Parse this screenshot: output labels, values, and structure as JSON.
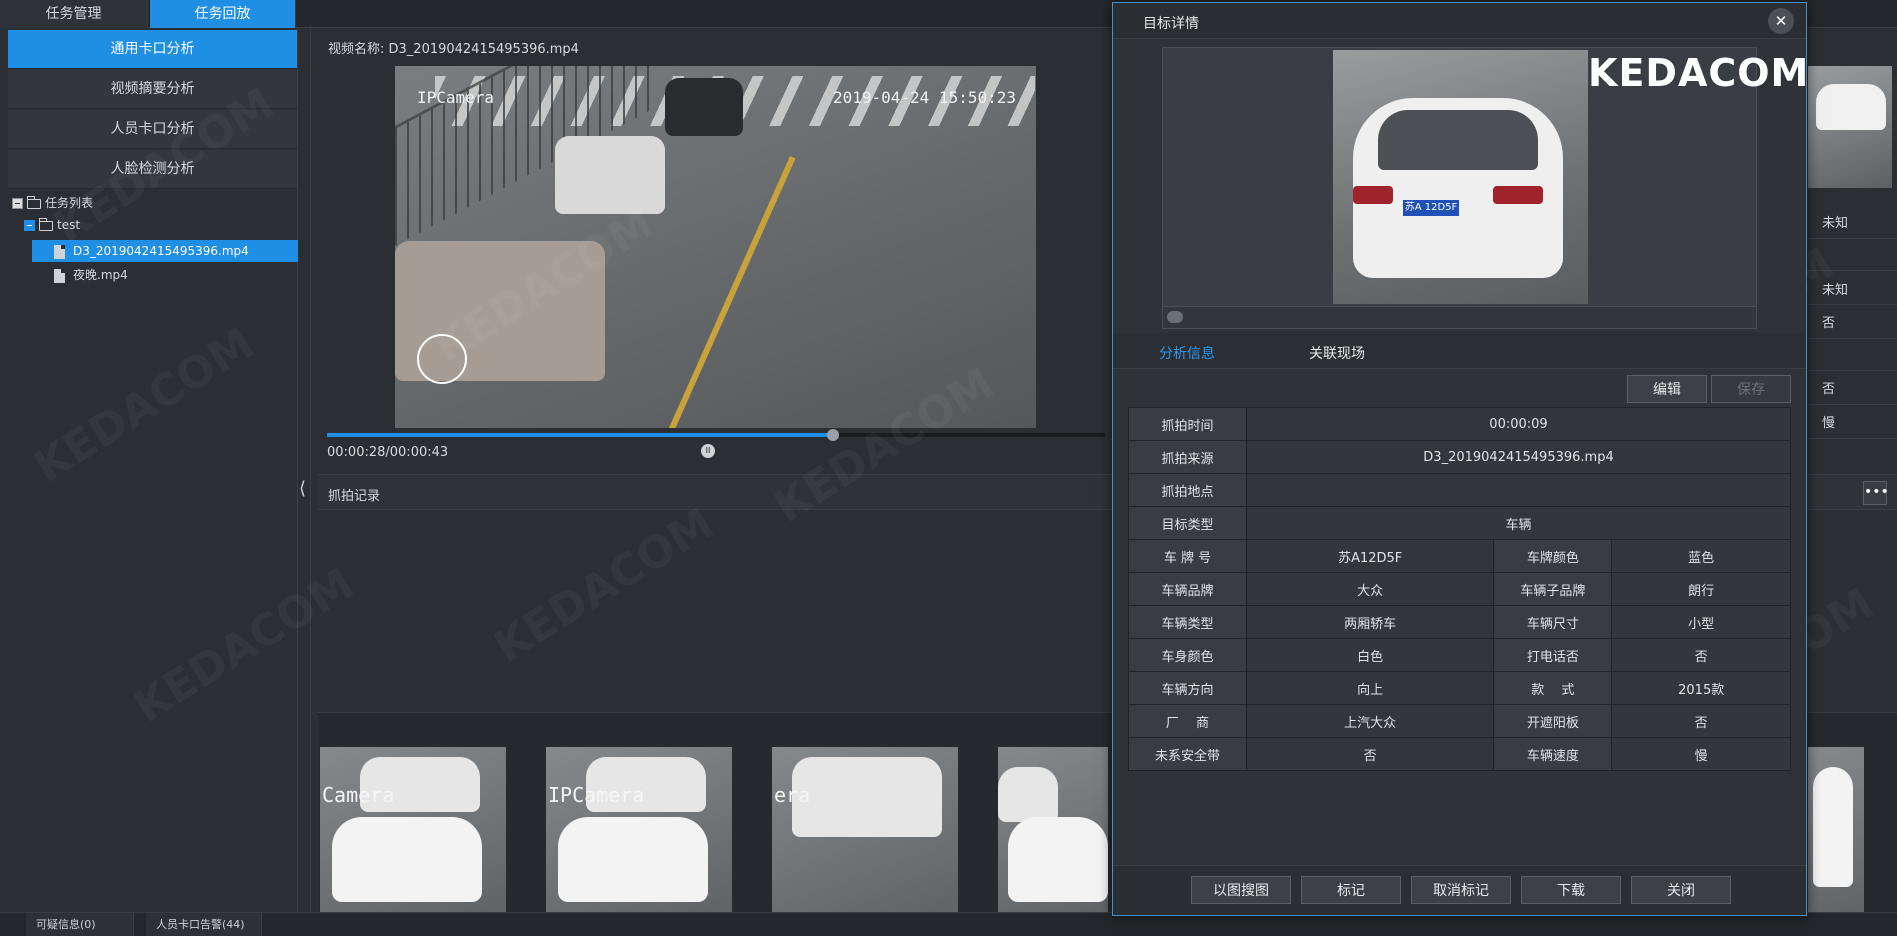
{
  "top_tabs": [
    "任务管理",
    "任务回放"
  ],
  "sidebar": {
    "nav": [
      "通用卡口分析",
      "视频摘要分析",
      "人员卡口分析",
      "人脸检测分析"
    ],
    "tree": {
      "root": "任务列表",
      "folder": "test",
      "files": [
        "D3_2019042415495396.mp4",
        "夜晚.mp4"
      ]
    }
  },
  "video": {
    "title": "视频名称: D3_2019042415495396.mp4",
    "camera_label": "IPCamera",
    "timestamp": "2019-04-24 15:50:23",
    "time_text": "00:00:28/00:00:43",
    "progress": 0.65
  },
  "capture": {
    "title": "抓拍记录",
    "more_label": "•••",
    "thumb_label": "Camera"
  },
  "right_values": [
    "未知",
    "未知",
    "否",
    "否",
    "慢"
  ],
  "statusbar": [
    "可疑信息(0)",
    "人员卡口告警(44)"
  ],
  "watermark": "KEDACOM",
  "dialog": {
    "title": "目标详情",
    "close": "✕",
    "logo": "KEDACOM",
    "plate_img": "苏A 12D5F",
    "tabs": [
      "分析信息",
      "关联现场"
    ],
    "edit_label": "编辑",
    "save_label": "保存",
    "rows": [
      {
        "k": "抓拍时间",
        "v": "00:00:09"
      },
      {
        "k": "抓拍来源",
        "v": "D3_2019042415495396.mp4"
      },
      {
        "k": "抓拍地点",
        "v": ""
      },
      {
        "k": "目标类型",
        "v": "车辆"
      }
    ],
    "pairs": [
      {
        "k1": "车 牌 号",
        "v1": "苏A12D5F",
        "k2": "车牌颜色",
        "v2": "蓝色"
      },
      {
        "k1": "车辆品牌",
        "v1": "大众",
        "k2": "车辆子品牌",
        "v2": "朗行"
      },
      {
        "k1": "车辆类型",
        "v1": "两厢轿车",
        "k2": "车辆尺寸",
        "v2": "小型"
      },
      {
        "k1": "车身颜色",
        "v1": "白色",
        "k2": "打电话否",
        "v2": "否"
      },
      {
        "k1": "车辆方向",
        "v1": "向上",
        "k2": "款　 式",
        "v2": "2015款"
      },
      {
        "k1": "厂　 商",
        "v1": "上汽大众",
        "k2": "开遮阳板",
        "v2": "否"
      },
      {
        "k1": "未系安全带",
        "v1": "否",
        "k2": "车辆速度",
        "v2": "慢"
      }
    ],
    "footer": [
      "以图搜图",
      "标记",
      "取消标记",
      "下载",
      "关闭"
    ]
  }
}
